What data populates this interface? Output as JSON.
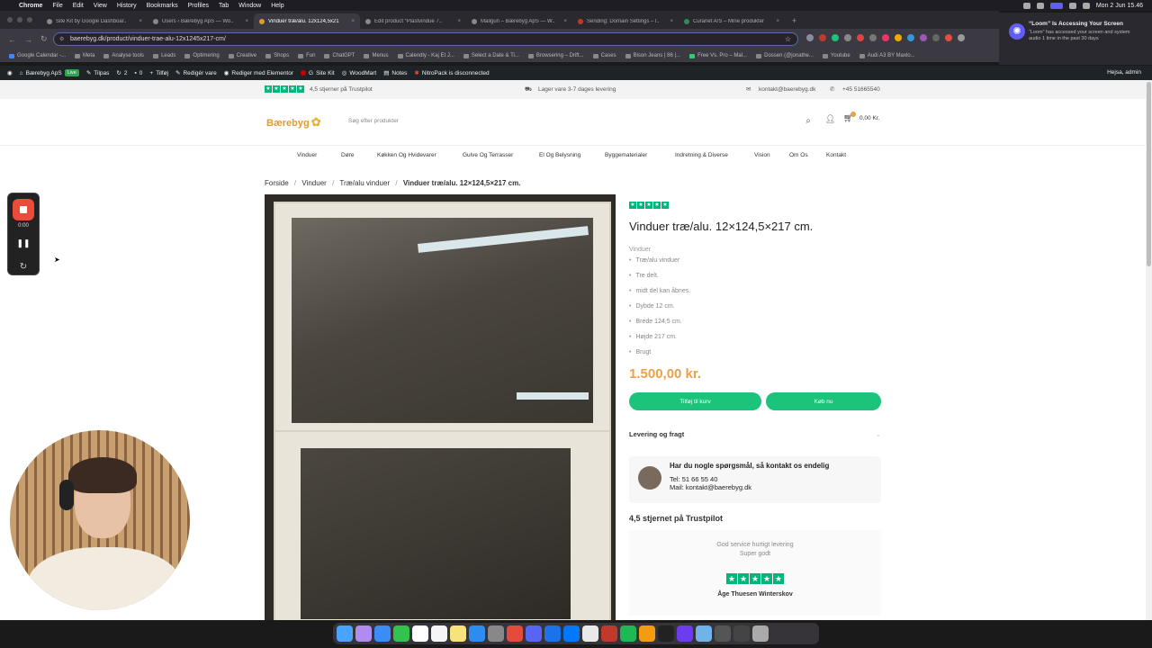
{
  "menubar": {
    "items": [
      "Chrome",
      "File",
      "Edit",
      "View",
      "History",
      "Bookmarks",
      "Profiles",
      "Tab",
      "Window",
      "Help"
    ],
    "clock": "Mon 2 Jun 15.46"
  },
  "tabs": [
    {
      "label": "Site Kit by Google Dashboar..",
      "active": false
    },
    {
      "label": "Users ‹ Bærebyg ApS — Wo..",
      "active": false
    },
    {
      "label": "Vinduer træ/alu. 12x124,5x21",
      "active": true
    },
    {
      "label": "Edit product “Plastvindue 7..",
      "active": false
    },
    {
      "label": "Mailgun – Bærebyg ApS — W..",
      "active": false
    },
    {
      "label": "Sending: Domain Settings – l..",
      "active": false
    },
    {
      "label": "Curanet A/S – Mine produkter",
      "active": false
    }
  ],
  "browser": {
    "url": "baerebyg.dk/product/vinduer-trae-alu-12x1245x217-cm/"
  },
  "bookmarks": [
    "Google Calendar -...",
    "Meta",
    "Analyse tools",
    "Leads",
    "Optimering",
    "Creative",
    "Shops",
    "Fun",
    "ChatGPT",
    "Menus",
    "Calendly - Kaj Et J...",
    "Select a Date & Ti...",
    "Browsering – Drift...",
    "Cases",
    "Bison Jeans | 86 |...",
    "Free Vs. Pro – Mal...",
    "Dossen (@jonathe...",
    "Youtube",
    "Audi A3 BY Maxlo...",
    "arks"
  ],
  "loom_notice": {
    "title": "“Loom” Is Accessing Your Screen",
    "body": "“Loom” has accessed your screen and system audio 1 time in the past 30 days"
  },
  "wp_admin": {
    "site_name": "Bærebyg ApS",
    "live": "Live",
    "customize": "Tilpas",
    "updates": "2",
    "comments": "0",
    "new": "Tilføj",
    "edit_product": "Redigér vare",
    "elementor": "Rediger med Elementor",
    "sitekit": "Site Kit",
    "woodmart": "WoodMart",
    "notes": "Notes",
    "nitropack": "NitroPack is disconnected",
    "greeting": "Hejsa, admin"
  },
  "topstrip": {
    "trustpilot": "4,5 stjerner på Trustpilot",
    "delivery": "Lager vare 3-7 dages levering",
    "email": "kontakt@baerebyg.dk",
    "phone": "+45 51665540"
  },
  "header": {
    "logo": "Bærebyg",
    "search_placeholder": "Søg efter produkter",
    "cart_total": "0,00 Kr."
  },
  "nav": [
    "Vinduer",
    "Døre",
    "Køkken Og Hvidevarer",
    "Gulve Og Terrasser",
    "El Og Belysning",
    "Byggematerialer",
    "Indretning & Diverse",
    "Vision",
    "Om Os",
    "Kontakt"
  ],
  "breadcrumb": [
    "Forside",
    "Vinduer",
    "Træ/alu vinduer",
    "Vinduer træ/alu. 12×124,5×217 cm."
  ],
  "product": {
    "title": "Vinduer træ/alu. 12×124,5×217 cm.",
    "category": "Vinduer",
    "features": [
      "Træ/alu vinduer",
      "Tre delt.",
      "midt del kan åbnes.",
      "Dybde 12 cm.",
      "Brede 124,5 cm.",
      "Højde 217 cm.",
      "Brugt"
    ],
    "price": "1.500,00 kr.",
    "add_to_cart": "Tilføj til kurv",
    "buy_now": "Køb nu",
    "shipping_tab": "Levering og fragt"
  },
  "contact_box": {
    "question": "Har du nogle spørgsmål, så kontakt os endelig",
    "tel": "Tel: 51 66 55 40",
    "mail": "Mail: kontakt@baerebyg.dk"
  },
  "trustpilot_section": {
    "title": "4,5 stjernet på Trustpilot",
    "review_line1": "God service hurtigt levering",
    "review_line2": "Super godt",
    "reviewer": "Åge Thuesen Winterskov"
  },
  "loom_controls": {
    "time": "0:00"
  },
  "colors": {
    "accent_green": "#1cc37a",
    "price_orange": "#e9a14a",
    "trustpilot_green": "#00b67a",
    "logo_orange": "#e39a2d"
  },
  "icons": [
    "search-icon",
    "user-icon",
    "cart-icon",
    "envelope-icon",
    "phone-icon",
    "truck-icon",
    "star-icon",
    "record-stop-icon",
    "pause-icon",
    "restart-icon"
  ]
}
